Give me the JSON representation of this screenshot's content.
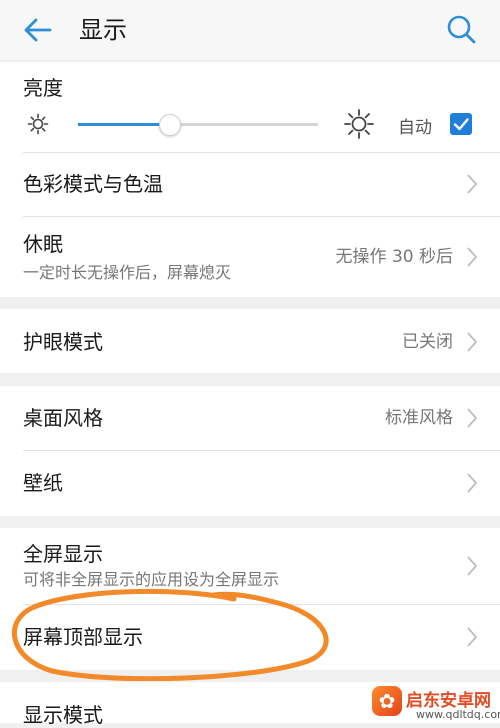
{
  "header": {
    "title": "显示"
  },
  "brightness": {
    "label": "亮度",
    "level_percent": 38,
    "auto_label": "自动",
    "auto_checked": true
  },
  "rows": {
    "color": {
      "label": "色彩模式与色温"
    },
    "sleep": {
      "label": "休眠",
      "sub": "一定时长无操作后，屏幕熄灭",
      "value": "无操作 30 秒后"
    },
    "eye": {
      "label": "护眼模式",
      "value": "已关闭"
    },
    "desktop": {
      "label": "桌面风格",
      "value": "标准风格"
    },
    "wallpaper": {
      "label": "壁纸"
    },
    "fullscreen": {
      "label": "全屏显示",
      "sub": "可将非全屏显示的应用设为全屏显示"
    },
    "topscreen": {
      "label": "屏幕顶部显示"
    },
    "displaymode": {
      "label": "显示模式"
    }
  },
  "colors": {
    "accent": "#2b90d9",
    "checkbox": "#1f7ed8",
    "annotation": "#f28a2a"
  },
  "watermark": {
    "title": "启东安卓网",
    "url": "www.qdltdq.com"
  }
}
